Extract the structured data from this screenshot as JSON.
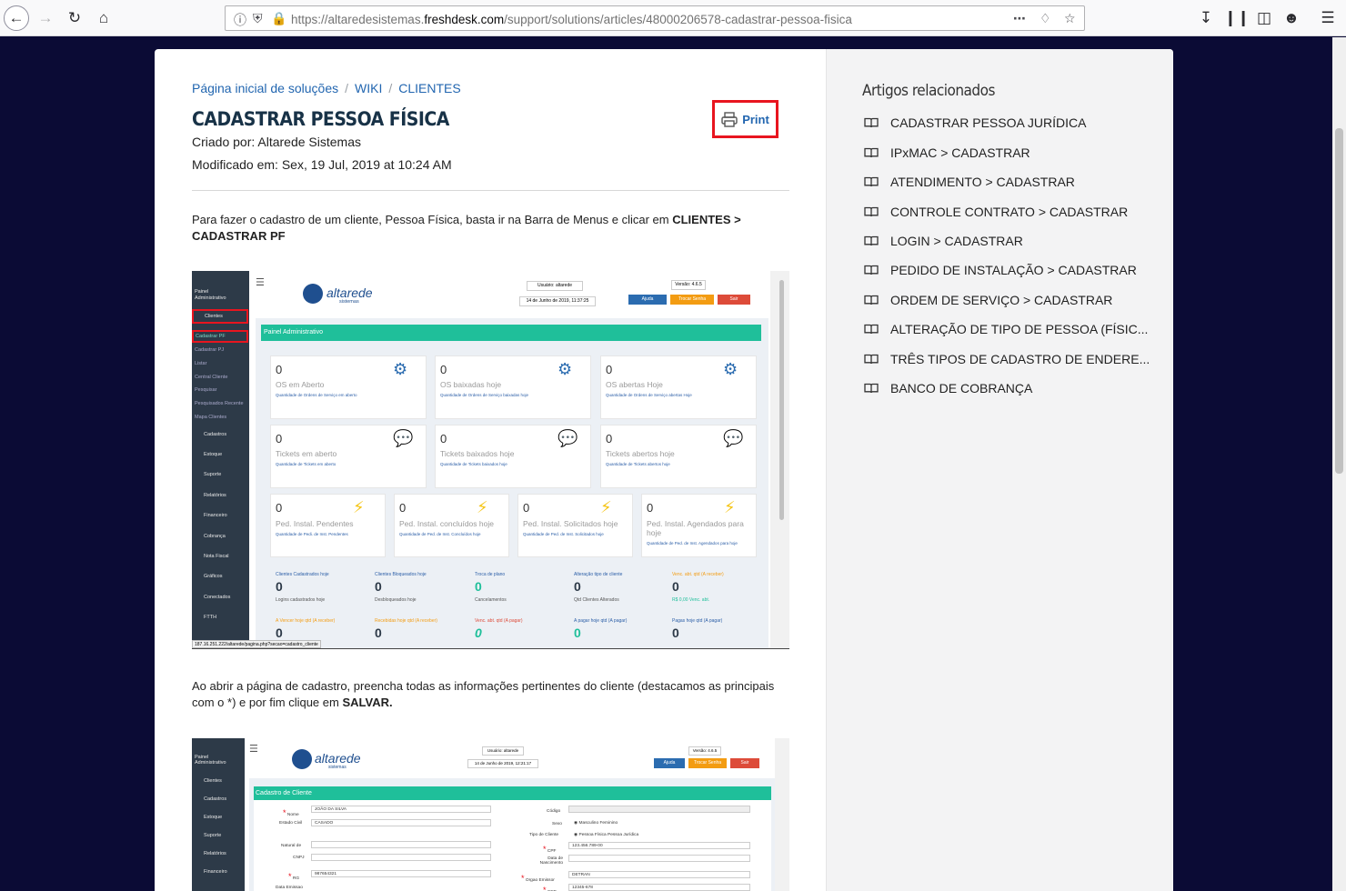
{
  "browser": {
    "url_prefix": "https://altaredesistemas.",
    "url_domain": "freshdesk.com",
    "url_path": "/support/solutions/articles/48000206578-cadastrar-pessoa-fisica"
  },
  "breadcrumb": [
    "Página inicial de soluções",
    "WIKI",
    "CLIENTES"
  ],
  "article": {
    "title": "CADASTRAR PESSOA FÍSICA",
    "author": "Criado por: Altarede Sistemas",
    "modified": "Modificado em: Sex, 19 Jul, 2019 at 10:24 AM",
    "print_label": "Print",
    "para1_start": "Para fazer o cadastro de um cliente, Pessoa Física, basta ir na Barra de Menus e clicar em ",
    "para1_bold": "CLIENTES > CADASTRAR PF",
    "para2_start": "Ao abrir a página de cadastro, preencha todas as informações pertinentes do cliente (destacamos as principais com o *) e por fim clique em ",
    "para2_bold": "SALVAR."
  },
  "related": {
    "heading": "Artigos relacionados",
    "items": [
      "CADASTRAR PESSOA JURÍDICA",
      "IPxMAC > CADASTRAR",
      "ATENDIMENTO > CADASTRAR",
      "CONTROLE CONTRATO > CADASTRAR",
      "LOGIN > CADASTRAR",
      "PEDIDO DE INSTALAÇÃO > CADASTRAR",
      "ORDEM DE SERVIÇO > CADASTRAR",
      "ALTERAÇÃO DE TIPO DE PESSOA (FÍSIC...",
      "TRÊS TIPOS DE CADASTRO DE ENDERE...",
      "BANCO DE COBRANÇA"
    ]
  },
  "shot1": {
    "sidebar": [
      "Painel",
      "Administrativo",
      "Clientes",
      "Cadastrar PF",
      "Cadastrar PJ",
      "Listar",
      "Central Cliente",
      "Pesquisar",
      "Pesquisados Recente",
      "Mapa Clientes",
      "Cadastros",
      "Estoque",
      "Suporte",
      "Relatórios",
      "Financeiro",
      "Cobrança",
      "Nota Fiscal",
      "Gráficos",
      "Conectados",
      "FTTH"
    ],
    "logo": "altarede",
    "logo_sub": "sistemas",
    "user": "Usuário: altarede",
    "date": "14 de Junho de 2019, 11:37:25",
    "version": "Versão: 4.6.5",
    "btn_help": "Ajuda",
    "btn_pass": "Trocar Senha",
    "btn_exit": "Sair",
    "panel": "Painel Administrativo",
    "cards": [
      {
        "n": "0",
        "l": "OS em Aberto",
        "s": "Quantidade de Ordens de Serviço em aberto"
      },
      {
        "n": "0",
        "l": "OS baixadas hoje",
        "s": "Quantidade de Ordens de Serviço baixadas hoje"
      },
      {
        "n": "0",
        "l": "OS abertas Hoje",
        "s": "Quantidade de Ordens de Serviço abertas Hoje"
      },
      {
        "n": "0",
        "l": "Tickets em aberto",
        "s": "Quantidade de Tickets em aberto"
      },
      {
        "n": "0",
        "l": "Tickets baixados hoje",
        "s": "Quantidade de Tickets baixados hoje"
      },
      {
        "n": "0",
        "l": "Tickets abertos hoje",
        "s": "Quantidade de Tickets abertos hoje"
      }
    ],
    "cards2": [
      {
        "n": "0",
        "l": "Ped. Instal. Pendentes",
        "s": "Quantidade de Pedi. de Inst. Pendentes"
      },
      {
        "n": "0",
        "l": "Ped. Instal. concluídos hoje",
        "s": "Quantidade de Ped. de Inst. Concluídos hoje"
      },
      {
        "n": "0",
        "l": "Ped. Instal. Solicitados hoje",
        "s": "Quantidade de Ped. de Inst. Solicitados hoje"
      },
      {
        "n": "0",
        "l": "Ped. Instal. Agendados para hoje",
        "s": "Quantidade de Ped. de Inst. Agendados para hoje"
      }
    ],
    "stats": [
      {
        "h": "Clientes Cadastrados hoje",
        "n": "0",
        "f": "Logins cadastrados hoje"
      },
      {
        "h": "Clientes Bloqueados hoje",
        "n": "0",
        "f": "Desbloqueados hoje"
      },
      {
        "h": "Troca de plano",
        "n": "0",
        "f": "Cancelamentos"
      },
      {
        "h": "Alteração tipo de cliente",
        "n": "0",
        "f": "Qtd Clientes Alterados"
      },
      {
        "h": "Venc. abt. qtd (A receber)",
        "n": "0",
        "f": "R$ 0,00 Venc. abt."
      }
    ],
    "stats2": [
      {
        "h": "A Vencer hoje qtd (A receber)",
        "n": "0"
      },
      {
        "h": "Recebidas hoje qtd (A receber)",
        "n": "0"
      },
      {
        "h": "Venc. abt. qtd (A pagar)",
        "n": "0"
      },
      {
        "h": "A pagar hoje qtd (A pagar)",
        "n": "0"
      },
      {
        "h": "Pagas hoje qtd (A pagar)",
        "n": "0"
      }
    ],
    "status_url": "187.16.251.222/altarede/pagina.php?secao=cadastro_cliente"
  },
  "shot2": {
    "sidebar": [
      "Painel",
      "Administrativo",
      "Clientes",
      "Cadastros",
      "Estoque",
      "Suporte",
      "Relatórios",
      "Financeiro"
    ],
    "user": "Usuário: altarede",
    "date": "14 de Junho de 2019, 12:21:17",
    "version": "Versão: 4.6.5",
    "panel": "Cadastro de Cliente",
    "left": [
      {
        "l": "Nome",
        "v": "JOÃO DA SILVA"
      },
      {
        "l": "Estado Civil",
        "v": "CASADO"
      },
      {
        "l": "Natural de",
        "v": ""
      },
      {
        "l": "CNPJ",
        "v": ""
      },
      {
        "l": "RG",
        "v": "987654321"
      },
      {
        "l": "Data Emissao",
        "v": ""
      }
    ],
    "right": [
      {
        "l": "Código",
        "v": ""
      },
      {
        "l": "Sexo",
        "v": "Masculino  Feminino"
      },
      {
        "l": "Tipo de Cliente",
        "v": "Pessoa Física  Pessoa Jurídica"
      },
      {
        "l": "CPF",
        "v": "123.456.789-00"
      },
      {
        "l": "Data de Nascimento",
        "v": ""
      },
      {
        "l": "Orgao Emissor",
        "v": "DETRAN"
      },
      {
        "l": "CEP",
        "v": "12345-678"
      }
    ]
  }
}
